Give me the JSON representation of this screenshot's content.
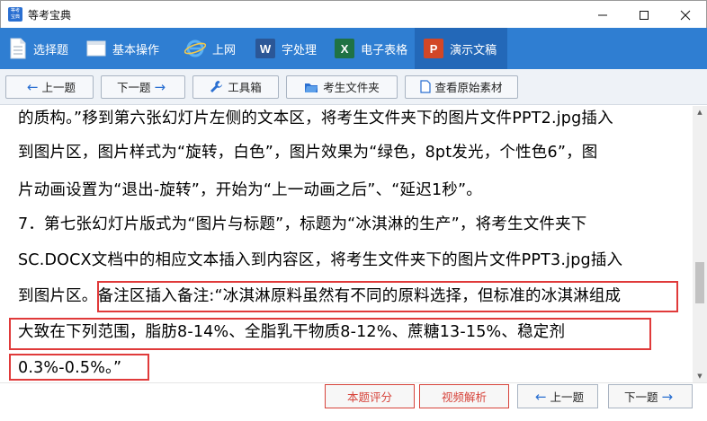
{
  "window": {
    "title": "等考宝典",
    "logo_text": "等考宝典"
  },
  "ribbon": {
    "items": [
      {
        "label": "选择题",
        "icon": "document-icon"
      },
      {
        "label": "基本操作",
        "icon": "window-icon"
      },
      {
        "label": "上网",
        "icon": "ie-icon"
      },
      {
        "label": "字处理",
        "icon": "word-icon",
        "badge": "W"
      },
      {
        "label": "电子表格",
        "icon": "excel-icon",
        "badge": "X"
      },
      {
        "label": "演示文稿",
        "icon": "powerpoint-icon",
        "badge": "P"
      }
    ],
    "active": "演示文稿"
  },
  "toolbar": {
    "prev": "上一题",
    "next": "下一题",
    "tools": "工具箱",
    "folder": "考生文件夹",
    "source": "查看原始素材"
  },
  "content": {
    "lines": [
      "的质构。”移到第六张幻灯片左侧的文本区，将考生文件夹下的图片文件PPT2.jpg插入",
      "到图片区，图片样式为“旋转，白色”，图片效果为“绿色，8pt发光，个性色6”，图",
      "片动画设置为“退出-旋转”，开始为“上一动画之后”、“延迟1秒”。",
      "7．第七张幻灯片版式为“图片与标题”，标题为“冰淇淋的生产”，将考生文件夹下",
      "SC.DOCX文档中的相应文本插入到内容区，将考生文件夹下的图片文件PPT3.jpg插入",
      "到图片区。备注区插入备注:“冰淇淋原料虽然有不同的原料选择，但标准的冰淇淋组成",
      "大致在下列范围，脂肪8-14%、全脂乳干物质8-12%、蔗糖13-15%、稳定剂",
      "0.3%-0.5%。”"
    ]
  },
  "bottom": {
    "score": "本题评分",
    "video": "视频解析",
    "prev": "上一题",
    "next": "下一题"
  },
  "colors": {
    "ribbon": "#2f7ed2",
    "highlight": "#e03a3a",
    "accent": "#2a6fd1"
  }
}
